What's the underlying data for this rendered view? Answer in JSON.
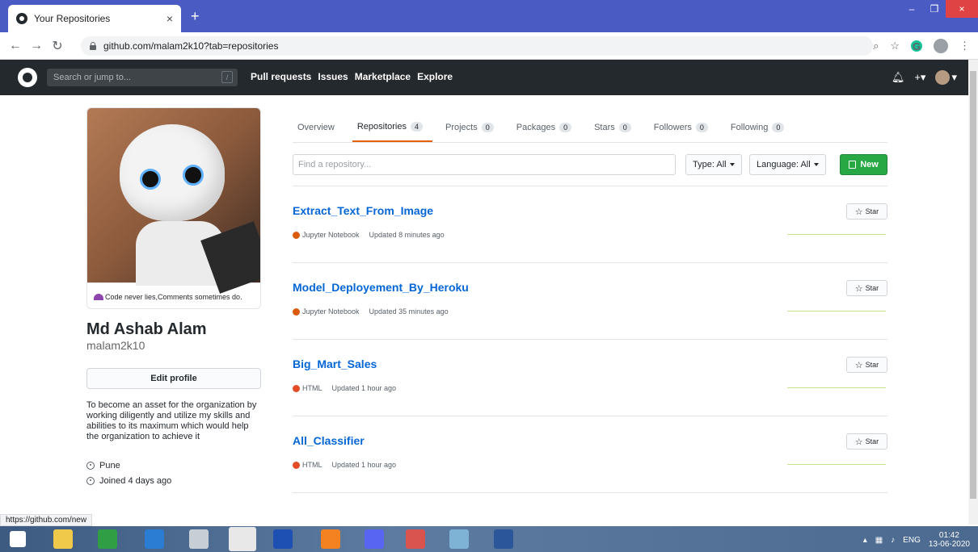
{
  "browser": {
    "tab_title": "Your Repositories",
    "tab_close": "×",
    "new_tab": "+",
    "url": "github.com/malam2k10?tab=repositories",
    "minimize": "–",
    "restore": "❐",
    "close": "×",
    "status_url": "https://github.com/new"
  },
  "gh_header": {
    "search_placeholder": "Search or jump to...",
    "search_key": "/",
    "nav": [
      "Pull requests",
      "Issues",
      "Marketplace",
      "Explore"
    ],
    "bell": "🔔",
    "plus": "+▾",
    "avatar_caret": "▾"
  },
  "profile": {
    "status_text": "Code never lies,Comments sometimes do.",
    "full_name": "Md Ashab Alam",
    "username": "malam2k10",
    "edit_label": "Edit profile",
    "bio": "To become an asset for the organization by working diligently and utilize my skills and abilities to its maximum which would help the organization to achieve it",
    "location": "Pune",
    "joined": "Joined 4 days ago"
  },
  "tabs": [
    {
      "label": "Overview",
      "count": ""
    },
    {
      "label": "Repositories",
      "count": "4"
    },
    {
      "label": "Projects",
      "count": "0"
    },
    {
      "label": "Packages",
      "count": "0"
    },
    {
      "label": "Stars",
      "count": "0"
    },
    {
      "label": "Followers",
      "count": "0"
    },
    {
      "label": "Following",
      "count": "0"
    }
  ],
  "filters": {
    "find_placeholder": "Find a repository...",
    "type_label": "Type: All",
    "language_label": "Language: All",
    "new_label": "New"
  },
  "repos": [
    {
      "name": "Extract_Text_From_Image",
      "language": "Jupyter Notebook",
      "lang_color": "#DA5B0B",
      "updated": "Updated 8 minutes ago",
      "star_label": "Star"
    },
    {
      "name": "Model_Deployement_By_Heroku",
      "language": "Jupyter Notebook",
      "lang_color": "#DA5B0B",
      "updated": "Updated 35 minutes ago",
      "star_label": "Star"
    },
    {
      "name": "Big_Mart_Sales",
      "language": "HTML",
      "lang_color": "#e34c26",
      "updated": "Updated 1 hour ago",
      "star_label": "Star"
    },
    {
      "name": "All_Classifier",
      "language": "HTML",
      "lang_color": "#e34c26",
      "updated": "Updated 1 hour ago",
      "star_label": "Star"
    }
  ],
  "taskbar": {
    "lang": "ENG",
    "time": "01:42",
    "date": "13-06-2020"
  },
  "colors": {
    "accent_blue": "#0366d6",
    "new_button_green": "#28a745",
    "tab_underline": "#e36209",
    "header_dark": "#24292e"
  }
}
